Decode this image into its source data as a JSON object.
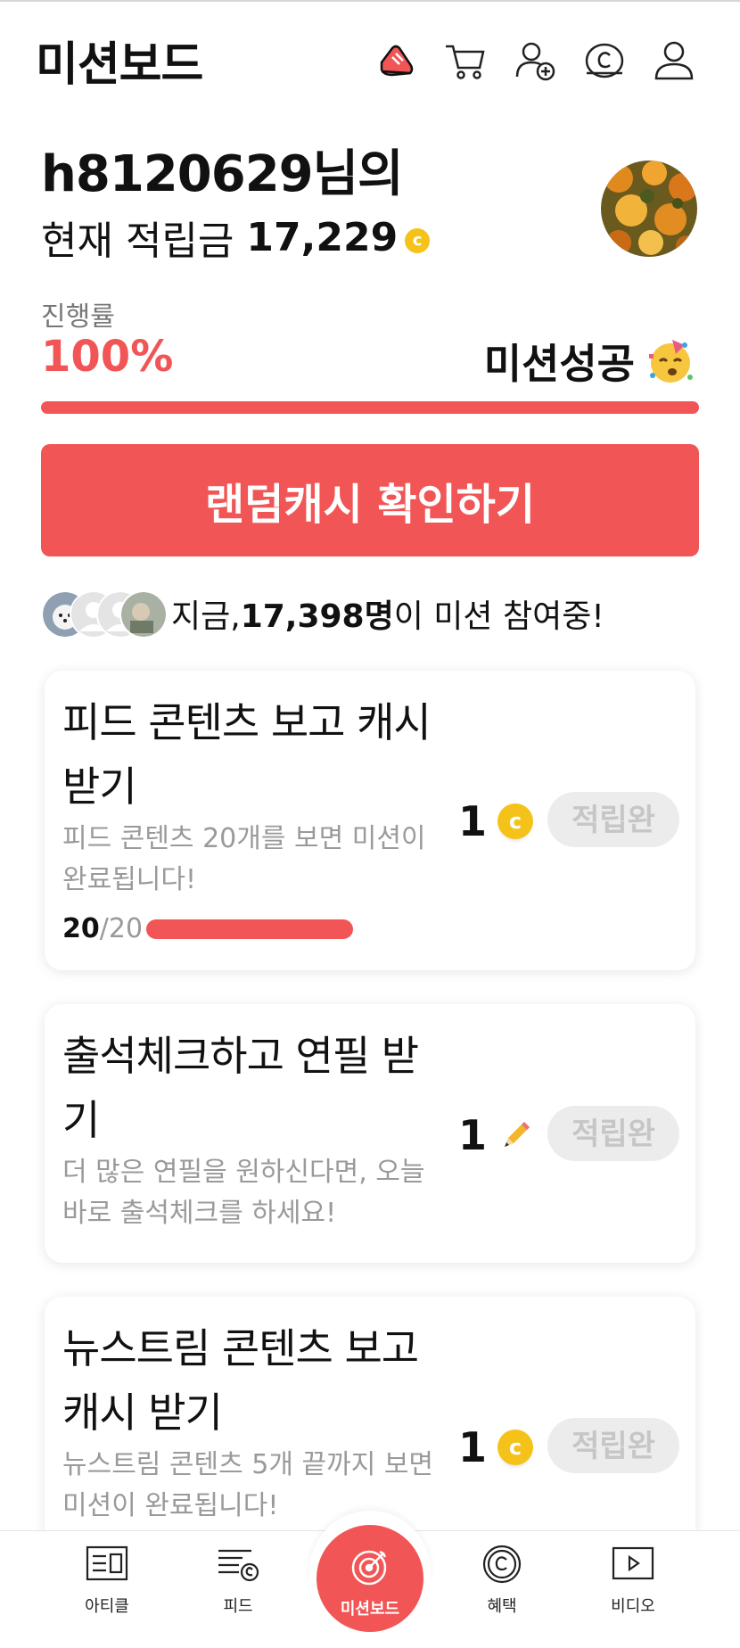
{
  "header": {
    "title": "미션보드",
    "icons": [
      "sneaker-icon",
      "cart-icon",
      "add-friend-icon",
      "cash-coin-icon",
      "profile-icon"
    ]
  },
  "user": {
    "name_line": "h8120629님의",
    "points_label": "현재 적립금",
    "points_value": "17,229",
    "coin_symbol": "c"
  },
  "progress": {
    "label": "진행률",
    "value": "100%",
    "percent": 100,
    "status": "미션성공"
  },
  "cta": {
    "label": "랜덤캐시 확인하기"
  },
  "participants": {
    "prefix": "지금, ",
    "count": "17,398명",
    "suffix": "이 미션 참여중!"
  },
  "missions": [
    {
      "title": "피드 콘텐츠 보고 캐시 받기",
      "desc": "피드 콘텐츠 20개를 보면 미션이 완료됩니다!",
      "reward": "1",
      "reward_icon": "coin-icon",
      "badge": "적립완",
      "progress_current": "20",
      "progress_sep": "/",
      "progress_total": "20",
      "progress_fraction": 1.0
    },
    {
      "title": "출석체크하고 연필 받기",
      "desc": "더 많은 연필을 원하신다면, 오늘 바로 출석체크를 하세요!",
      "reward": "1",
      "reward_icon": "pencil-icon",
      "badge": "적립완"
    },
    {
      "title": "뉴스트림 콘텐츠 보고 캐시 받기",
      "desc": "뉴스트림 콘텐츠 5개 끝까지 보면 미션이 완료됩니다!",
      "reward": "1",
      "reward_icon": "coin-icon",
      "badge": "적립완"
    }
  ],
  "nav": {
    "article": "아티클",
    "feed": "피드",
    "mission_board": "미션보드",
    "benefit": "혜택",
    "video": "비디오"
  },
  "colors": {
    "accent": "#f25555",
    "coin": "#f5c21a",
    "badge_bg": "#ececec",
    "badge_text": "#c6c6c6"
  }
}
